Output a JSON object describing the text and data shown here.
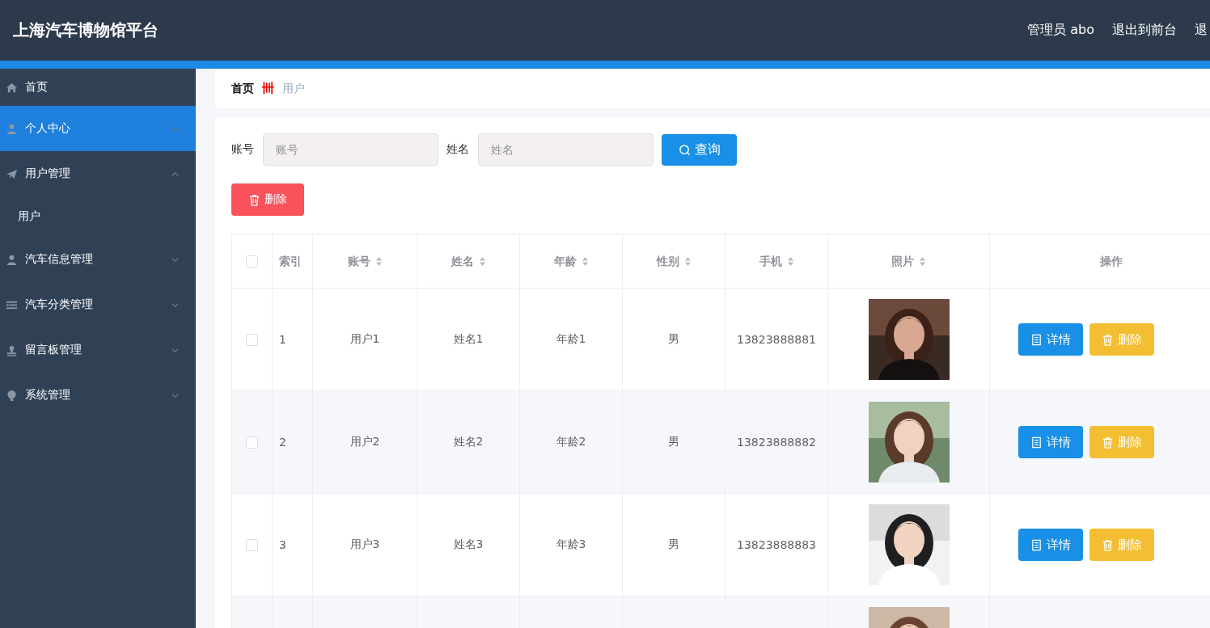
{
  "header": {
    "title": "上海汽车博物馆平台",
    "links": [
      "管理员 abo",
      "退出到前台",
      "退"
    ]
  },
  "sidebar": {
    "items": [
      {
        "label": "首页",
        "selected": false
      },
      {
        "label": "个人中心",
        "selected": true,
        "expanded": false
      },
      {
        "label": "用户管理",
        "selected": false,
        "expanded": true,
        "children": [
          {
            "label": "用户",
            "selected": false
          }
        ]
      },
      {
        "label": "汽车信息管理",
        "selected": false,
        "expanded": false
      },
      {
        "label": "汽车分类管理",
        "selected": false,
        "expanded": false
      },
      {
        "label": "留言板管理",
        "selected": false,
        "expanded": false
      },
      {
        "label": "系统管理",
        "selected": false,
        "expanded": false
      }
    ]
  },
  "breadcrumb": {
    "items": [
      "首页",
      "用户"
    ],
    "separator": "卌"
  },
  "search": {
    "fields": [
      {
        "label": "账号",
        "placeholder": "账号"
      },
      {
        "label": "姓名",
        "placeholder": "姓名"
      }
    ],
    "button": "查询"
  },
  "delete_button": "删除",
  "table": {
    "select_all": {
      "checked": false
    },
    "columns": [
      {
        "label": "索引",
        "sortable": false
      },
      {
        "label": "账号",
        "sortable": true
      },
      {
        "label": "姓名",
        "sortable": true
      },
      {
        "label": "年龄",
        "sortable": true
      },
      {
        "label": "性别",
        "sortable": true
      },
      {
        "label": "手机",
        "sortable": true
      },
      {
        "label": "照片",
        "sortable": true
      },
      {
        "label": "操作",
        "sortable": false
      }
    ],
    "rows": [
      {
        "checked": false,
        "cells": [
          "1",
          "用户1",
          "姓名1",
          "年龄1",
          "男",
          "13823888881"
        ],
        "photo": {
          "kind": "picture"
        },
        "actions": [
          "详情",
          "删除"
        ]
      },
      {
        "checked": false,
        "cells": [
          "2",
          "用户2",
          "姓名2",
          "年龄2",
          "男",
          "13823888882"
        ],
        "photo": {
          "kind": "picture"
        },
        "actions": [
          "详情",
          "删除"
        ]
      },
      {
        "checked": false,
        "cells": [
          "3",
          "用户3",
          "姓名3",
          "年龄3",
          "男",
          "13823888883"
        ],
        "photo": {
          "kind": "picture"
        },
        "actions": [
          "详情",
          "删除"
        ]
      },
      {
        "photo": {
          "kind": "picture"
        }
      }
    ]
  }
}
